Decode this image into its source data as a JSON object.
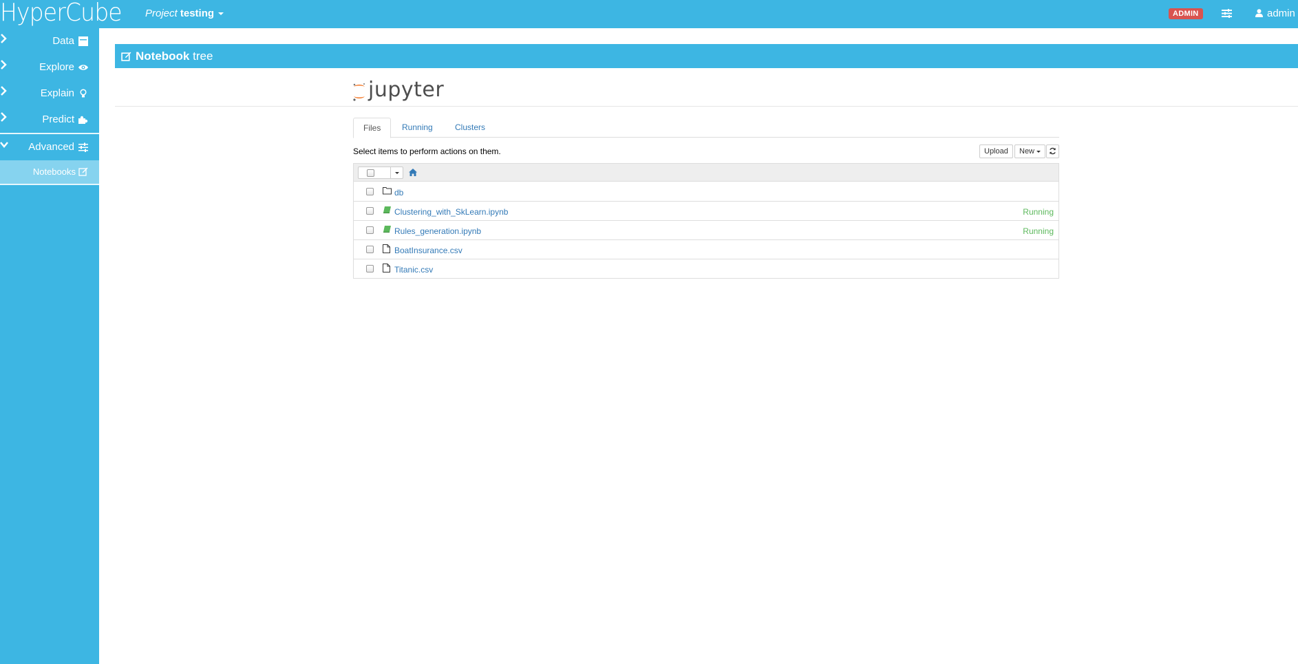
{
  "header": {
    "brand": "HyperCube",
    "project_prefix": "Project",
    "project_name": "testing",
    "admin_badge": "ADMIN",
    "settings_icon": "sliders-icon",
    "user_name": "admin"
  },
  "sidebar": {
    "items": [
      {
        "label": "Data",
        "icon": "table-icon"
      },
      {
        "label": "Explore",
        "icon": "eye-icon"
      },
      {
        "label": "Explain",
        "icon": "lightbulb-icon"
      },
      {
        "label": "Predict",
        "icon": "puzzle-icon"
      },
      {
        "label": "Advanced",
        "icon": "sliders-icon"
      }
    ],
    "sub_item": {
      "label": "Notebooks",
      "icon": "edit-icon"
    }
  },
  "panel": {
    "title_bold": "Notebook",
    "title_rest": " tree"
  },
  "jupyter": {
    "logo_text": "jupyter",
    "tabs": [
      {
        "label": "Files"
      },
      {
        "label": "Running"
      },
      {
        "label": "Clusters"
      }
    ],
    "hint": "Select items to perform actions on them.",
    "upload_label": "Upload",
    "new_label": "New",
    "files": [
      {
        "name": "db",
        "type": "folder",
        "status": ""
      },
      {
        "name": "Clustering_with_SkLearn.ipynb",
        "type": "notebook",
        "status": "Running"
      },
      {
        "name": "Rules_generation.ipynb",
        "type": "notebook",
        "status": "Running"
      },
      {
        "name": "BoatInsurance.csv",
        "type": "file",
        "status": ""
      },
      {
        "name": "Titanic.csv",
        "type": "file",
        "status": ""
      }
    ]
  },
  "colors": {
    "brand": "#3db6e3",
    "sub_item_bg": "#86d3ef",
    "badge": "#d9534f",
    "running": "#5cb85c",
    "link": "#337ab7"
  }
}
